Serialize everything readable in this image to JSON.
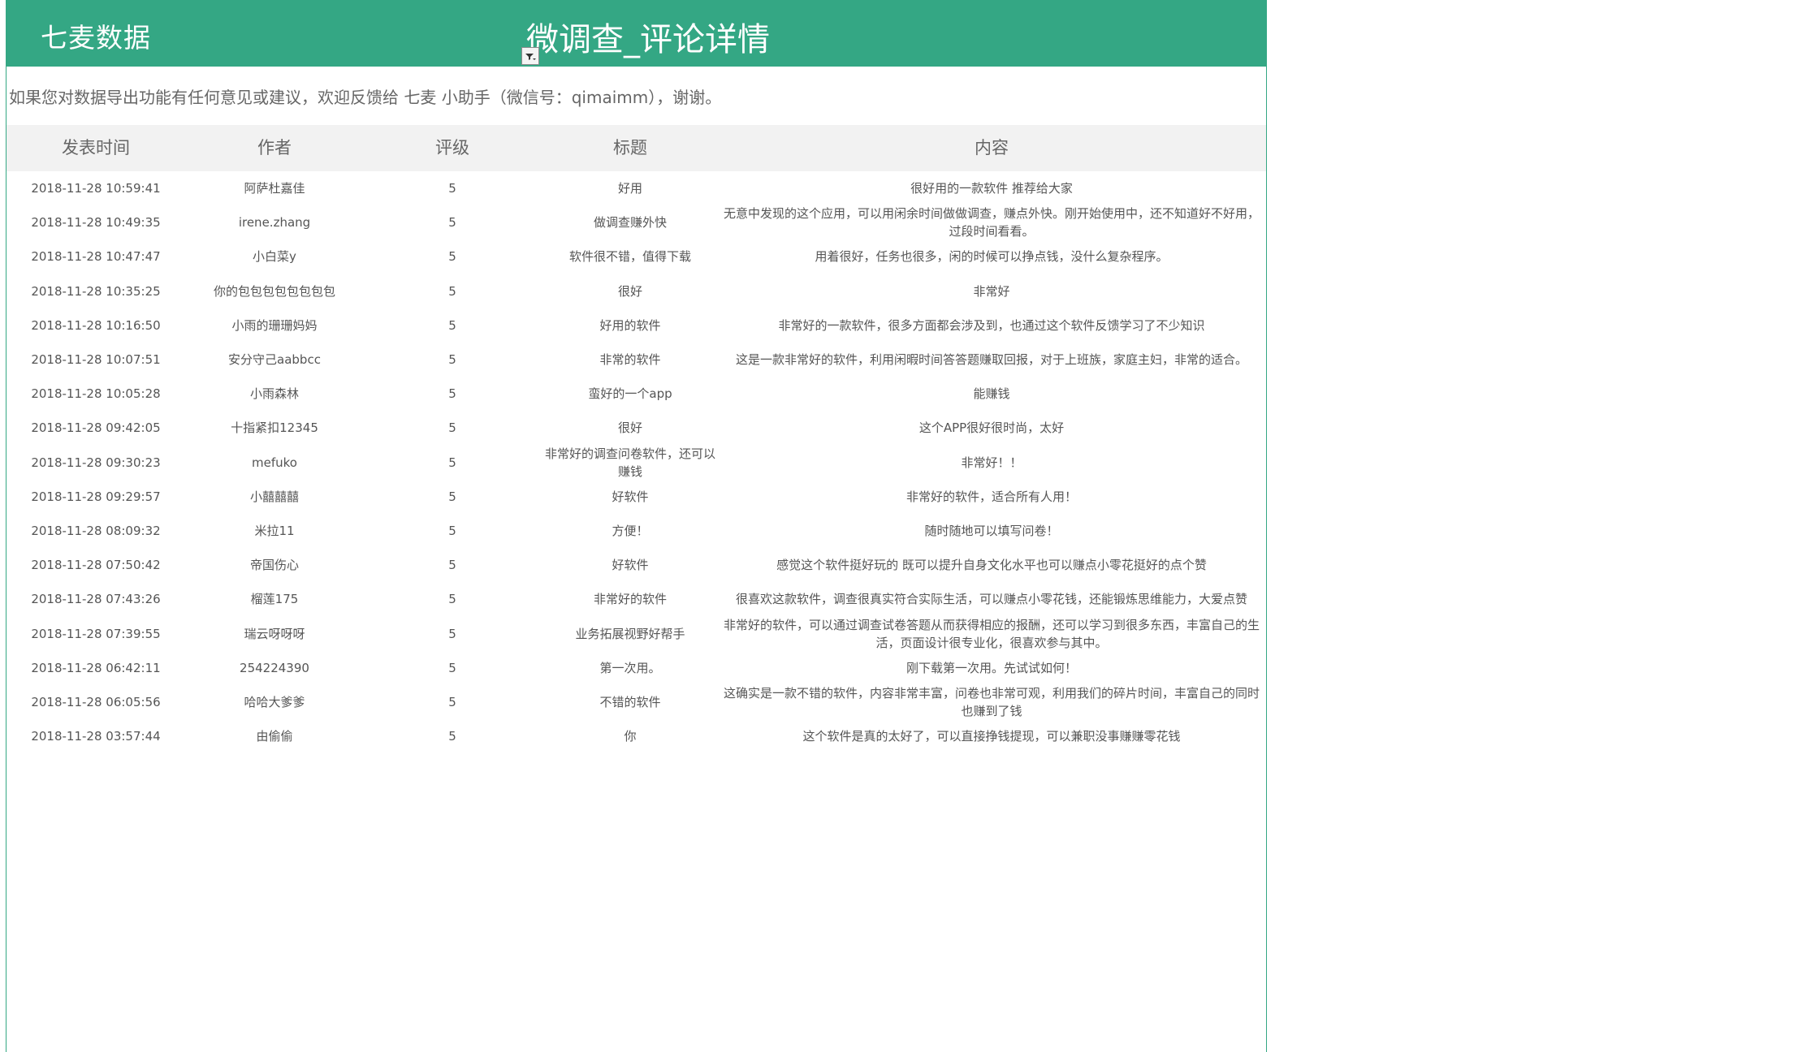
{
  "header": {
    "brand": "七麦数据",
    "title": "微调查_评论详情"
  },
  "notice": "如果您对数据导出功能有任何意见或建议，欢迎反馈给 七麦 小助手（微信号：qimaimm），谢谢。",
  "table": {
    "columns": [
      "发表时间",
      "作者",
      "评级",
      "标题",
      "内容"
    ],
    "rows": [
      {
        "time": "2018-11-28 10:59:41",
        "author": "阿萨杜嘉佳",
        "rating": "5",
        "title": "好用",
        "content": "很好用的一款软件 推荐给大家"
      },
      {
        "time": "2018-11-28 10:49:35",
        "author": "irene.zhang",
        "rating": "5",
        "title": "做调查赚外快",
        "content": "无意中发现的这个应用，可以用闲余时间做做调查，赚点外快。刚开始使用中，还不知道好不好用，过段时间看看。"
      },
      {
        "time": "2018-11-28 10:47:47",
        "author": "小白菜y",
        "rating": "5",
        "title": "软件很不错，值得下载",
        "content": "用着很好，任务也很多，闲的时候可以挣点钱，没什么复杂程序。"
      },
      {
        "time": "2018-11-28 10:35:25",
        "author": "你的包包包包包包包包",
        "rating": "5",
        "title": "很好",
        "content": "非常好"
      },
      {
        "time": "2018-11-28 10:16:50",
        "author": "小雨的珊珊妈妈",
        "rating": "5",
        "title": "好用的软件",
        "content": "非常好的一款软件，很多方面都会涉及到，也通过这个软件反馈学习了不少知识"
      },
      {
        "time": "2018-11-28 10:07:51",
        "author": "安分守己aabbcc",
        "rating": "5",
        "title": "非常的软件",
        "content": "这是一款非常好的软件，利用闲暇时间答答题赚取回报，对于上班族，家庭主妇，非常的适合。"
      },
      {
        "time": "2018-11-28 10:05:28",
        "author": "小雨森林",
        "rating": "5",
        "title": "蛮好的一个app",
        "content": "能赚钱"
      },
      {
        "time": "2018-11-28 09:42:05",
        "author": "十指紧扣12345",
        "rating": "5",
        "title": "很好",
        "content": "这个APP很好很时尚，太好"
      },
      {
        "time": "2018-11-28 09:30:23",
        "author": "mefuko",
        "rating": "5",
        "title": "非常好的调查问卷软件，还可以赚钱",
        "content": "非常好！！"
      },
      {
        "time": "2018-11-28 09:29:57",
        "author": "小囍囍囍",
        "rating": "5",
        "title": "好软件",
        "content": "非常好的软件，适合所有人用！"
      },
      {
        "time": "2018-11-28 08:09:32",
        "author": "米拉11",
        "rating": "5",
        "title": "方便！",
        "content": "随时随地可以填写问卷！"
      },
      {
        "time": "2018-11-28 07:50:42",
        "author": "帝国伤心",
        "rating": "5",
        "title": "好软件",
        "content": "感觉这个软件挺好玩的 既可以提升自身文化水平也可以赚点小零花挺好的点个赞"
      },
      {
        "time": "2018-11-28 07:43:26",
        "author": "榴莲175",
        "rating": "5",
        "title": "非常好的软件",
        "content": "很喜欢这款软件，调查很真实符合实际生活，可以赚点小零花钱，还能锻炼思维能力，大爱点赞"
      },
      {
        "time": "2018-11-28 07:39:55",
        "author": "瑞云呀呀呀",
        "rating": "5",
        "title": "业务拓展视野好帮手",
        "content": "非常好的软件，可以通过调查试卷答题从而获得相应的报酬，还可以学习到很多东西，丰富自己的生活，页面设计很专业化，很喜欢参与其中。"
      },
      {
        "time": "2018-11-28 06:42:11",
        "author": "254224390",
        "rating": "5",
        "title": "第一次用。",
        "content": "刚下载第一次用。先试试如何！"
      },
      {
        "time": "2018-11-28 06:05:56",
        "author": "哈哈大爹爹",
        "rating": "5",
        "title": "不错的软件",
        "content": "这确实是一款不错的软件，内容非常丰富，问卷也非常可观，利用我们的碎片时间，丰富自己的同时也赚到了钱"
      },
      {
        "time": "2018-11-28 03:57:44",
        "author": "由偷偷",
        "rating": "5",
        "title": "你",
        "content": "这个软件是真的太好了，可以直接挣钱提现，可以兼职没事赚赚零花钱"
      }
    ]
  }
}
